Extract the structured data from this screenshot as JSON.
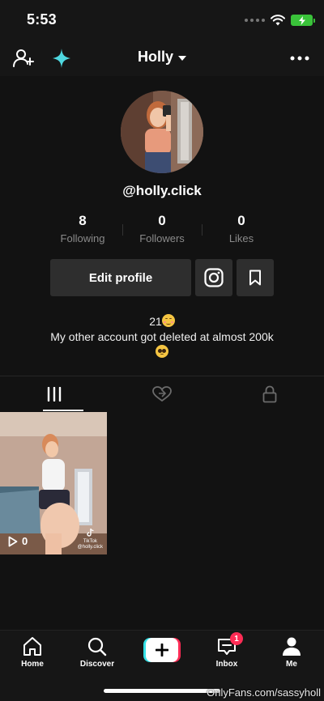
{
  "status": {
    "time": "5:53",
    "icons": [
      "signal-dots-icon",
      "wifi-icon",
      "battery-charging-icon"
    ]
  },
  "header": {
    "title": "Holly",
    "icons": [
      "add-user-icon",
      "sparkle-icon",
      "chevron-down-icon",
      "more-icon"
    ]
  },
  "profile": {
    "handle": "@holly.click",
    "stats": [
      {
        "value": "8",
        "label": "Following"
      },
      {
        "value": "0",
        "label": "Followers"
      },
      {
        "value": "0",
        "label": "Likes"
      }
    ],
    "edit_label": "Edit profile",
    "bio_line1": "21",
    "bio_line2": "My other account got deleted at almost 200k"
  },
  "tabs": [
    "videos-grid-icon",
    "liked-heart-icon",
    "private-lock-icon"
  ],
  "videos": [
    {
      "views": "0",
      "watermark_line1": "TikTok",
      "watermark_line2": "@holly.click"
    }
  ],
  "bottom_nav": {
    "items": [
      {
        "label": "Home",
        "icon": "home-icon"
      },
      {
        "label": "Discover",
        "icon": "search-icon"
      },
      {
        "label": "Inbox",
        "icon": "inbox-icon",
        "badge": "1"
      },
      {
        "label": "Me",
        "icon": "profile-icon"
      }
    ]
  },
  "watermark": "OnlyFans.com/sassyholl",
  "colors": {
    "background": "#121212",
    "button_bg": "#2e2e2e",
    "badge_red": "#ff2c55",
    "sparkle_cyan": "#4fd8e0"
  }
}
